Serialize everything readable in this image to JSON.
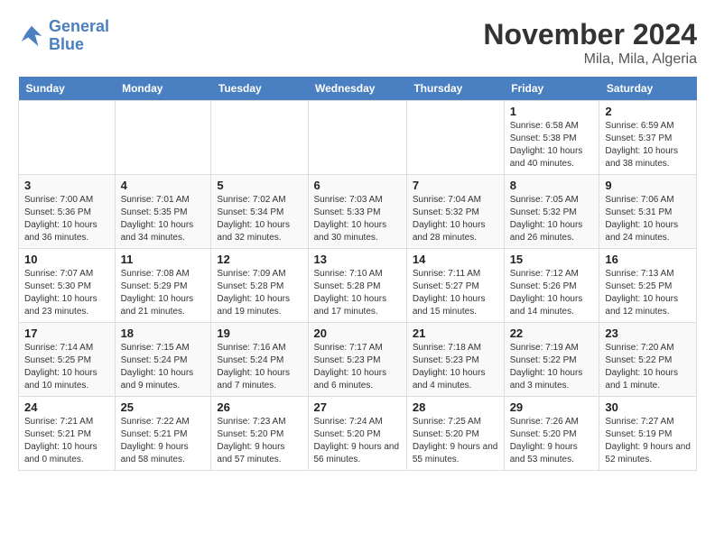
{
  "logo": {
    "line1": "General",
    "line2": "Blue"
  },
  "title": "November 2024",
  "location": "Mila, Mila, Algeria",
  "days_of_week": [
    "Sunday",
    "Monday",
    "Tuesday",
    "Wednesday",
    "Thursday",
    "Friday",
    "Saturday"
  ],
  "weeks": [
    [
      {
        "day": "",
        "info": ""
      },
      {
        "day": "",
        "info": ""
      },
      {
        "day": "",
        "info": ""
      },
      {
        "day": "",
        "info": ""
      },
      {
        "day": "",
        "info": ""
      },
      {
        "day": "1",
        "info": "Sunrise: 6:58 AM\nSunset: 5:38 PM\nDaylight: 10 hours and 40 minutes."
      },
      {
        "day": "2",
        "info": "Sunrise: 6:59 AM\nSunset: 5:37 PM\nDaylight: 10 hours and 38 minutes."
      }
    ],
    [
      {
        "day": "3",
        "info": "Sunrise: 7:00 AM\nSunset: 5:36 PM\nDaylight: 10 hours and 36 minutes."
      },
      {
        "day": "4",
        "info": "Sunrise: 7:01 AM\nSunset: 5:35 PM\nDaylight: 10 hours and 34 minutes."
      },
      {
        "day": "5",
        "info": "Sunrise: 7:02 AM\nSunset: 5:34 PM\nDaylight: 10 hours and 32 minutes."
      },
      {
        "day": "6",
        "info": "Sunrise: 7:03 AM\nSunset: 5:33 PM\nDaylight: 10 hours and 30 minutes."
      },
      {
        "day": "7",
        "info": "Sunrise: 7:04 AM\nSunset: 5:32 PM\nDaylight: 10 hours and 28 minutes."
      },
      {
        "day": "8",
        "info": "Sunrise: 7:05 AM\nSunset: 5:32 PM\nDaylight: 10 hours and 26 minutes."
      },
      {
        "day": "9",
        "info": "Sunrise: 7:06 AM\nSunset: 5:31 PM\nDaylight: 10 hours and 24 minutes."
      }
    ],
    [
      {
        "day": "10",
        "info": "Sunrise: 7:07 AM\nSunset: 5:30 PM\nDaylight: 10 hours and 23 minutes."
      },
      {
        "day": "11",
        "info": "Sunrise: 7:08 AM\nSunset: 5:29 PM\nDaylight: 10 hours and 21 minutes."
      },
      {
        "day": "12",
        "info": "Sunrise: 7:09 AM\nSunset: 5:28 PM\nDaylight: 10 hours and 19 minutes."
      },
      {
        "day": "13",
        "info": "Sunrise: 7:10 AM\nSunset: 5:28 PM\nDaylight: 10 hours and 17 minutes."
      },
      {
        "day": "14",
        "info": "Sunrise: 7:11 AM\nSunset: 5:27 PM\nDaylight: 10 hours and 15 minutes."
      },
      {
        "day": "15",
        "info": "Sunrise: 7:12 AM\nSunset: 5:26 PM\nDaylight: 10 hours and 14 minutes."
      },
      {
        "day": "16",
        "info": "Sunrise: 7:13 AM\nSunset: 5:25 PM\nDaylight: 10 hours and 12 minutes."
      }
    ],
    [
      {
        "day": "17",
        "info": "Sunrise: 7:14 AM\nSunset: 5:25 PM\nDaylight: 10 hours and 10 minutes."
      },
      {
        "day": "18",
        "info": "Sunrise: 7:15 AM\nSunset: 5:24 PM\nDaylight: 10 hours and 9 minutes."
      },
      {
        "day": "19",
        "info": "Sunrise: 7:16 AM\nSunset: 5:24 PM\nDaylight: 10 hours and 7 minutes."
      },
      {
        "day": "20",
        "info": "Sunrise: 7:17 AM\nSunset: 5:23 PM\nDaylight: 10 hours and 6 minutes."
      },
      {
        "day": "21",
        "info": "Sunrise: 7:18 AM\nSunset: 5:23 PM\nDaylight: 10 hours and 4 minutes."
      },
      {
        "day": "22",
        "info": "Sunrise: 7:19 AM\nSunset: 5:22 PM\nDaylight: 10 hours and 3 minutes."
      },
      {
        "day": "23",
        "info": "Sunrise: 7:20 AM\nSunset: 5:22 PM\nDaylight: 10 hours and 1 minute."
      }
    ],
    [
      {
        "day": "24",
        "info": "Sunrise: 7:21 AM\nSunset: 5:21 PM\nDaylight: 10 hours and 0 minutes."
      },
      {
        "day": "25",
        "info": "Sunrise: 7:22 AM\nSunset: 5:21 PM\nDaylight: 9 hours and 58 minutes."
      },
      {
        "day": "26",
        "info": "Sunrise: 7:23 AM\nSunset: 5:20 PM\nDaylight: 9 hours and 57 minutes."
      },
      {
        "day": "27",
        "info": "Sunrise: 7:24 AM\nSunset: 5:20 PM\nDaylight: 9 hours and 56 minutes."
      },
      {
        "day": "28",
        "info": "Sunrise: 7:25 AM\nSunset: 5:20 PM\nDaylight: 9 hours and 55 minutes."
      },
      {
        "day": "29",
        "info": "Sunrise: 7:26 AM\nSunset: 5:20 PM\nDaylight: 9 hours and 53 minutes."
      },
      {
        "day": "30",
        "info": "Sunrise: 7:27 AM\nSunset: 5:19 PM\nDaylight: 9 hours and 52 minutes."
      }
    ]
  ]
}
